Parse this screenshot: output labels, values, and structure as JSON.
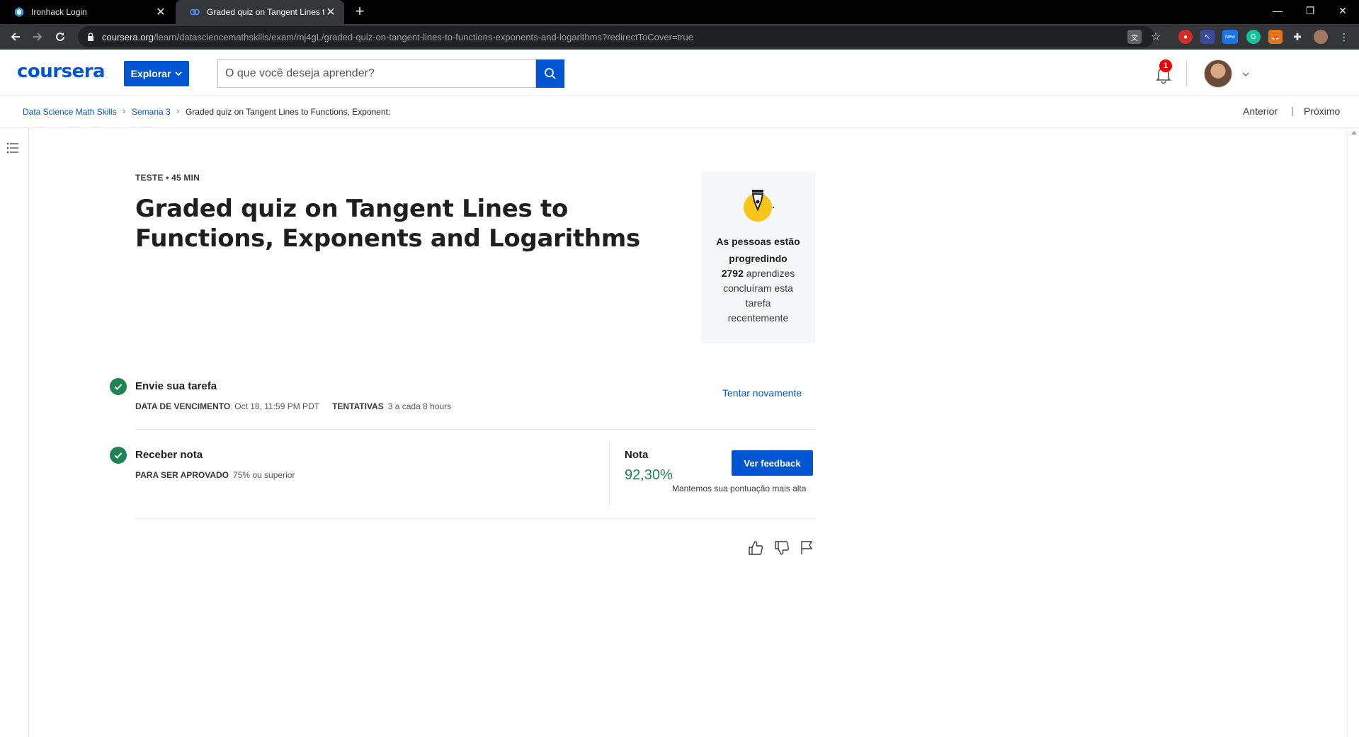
{
  "browser": {
    "tabs": [
      {
        "title": "Ironhack Login",
        "active": false
      },
      {
        "title": "Graded quiz on Tangent Lines to",
        "active": true
      }
    ],
    "url_host": "coursera.org",
    "url_path": "/learn/datasciencemathskills/exam/mj4gL/graded-quiz-on-tangent-lines-to-functions-exponents-and-logarithms?redirectToCover=true",
    "extensions": [
      "translate-icon",
      "star-icon",
      "lastpass-icon",
      "extension-icon",
      "new-extension-icon",
      "grammarly-icon",
      "fox-icon",
      "puzzle-icon",
      "profile-icon"
    ],
    "extension_new_label": "New"
  },
  "header": {
    "logo": "coursera",
    "explore_label": "Explorar",
    "search_placeholder": "O que você deseja aprender?",
    "notification_count": "1",
    "brand_color": "#0056d2"
  },
  "breadcrumb": {
    "items": [
      "Data Science Math Skills",
      "Semana 3",
      "Graded quiz on Tangent Lines to Functions, Exponent:"
    ],
    "prev_label": "Anterior",
    "next_label": "Próximo"
  },
  "quiz": {
    "kicker": "TESTE • 45 MIN",
    "title": "Graded quiz on Tangent Lines to Functions, Exponents and Logarithms"
  },
  "progress_card": {
    "heading": "As pessoas estão progredindo",
    "count": "2792",
    "body": "aprendizes concluíram esta tarefa recentemente"
  },
  "submit_step": {
    "title": "Envie sua tarefa",
    "due_label": "DATA DE VENCIMENTO",
    "due_value": "Oct 18, 11:59 PM PDT",
    "attempts_label": "TENTATIVAS",
    "attempts_value": "3 a cada 8 hours",
    "retry_label": "Tentar novamente"
  },
  "grade_step": {
    "title": "Receber nota",
    "pass_label": "PARA SER APROVADO",
    "pass_value": "75% ou superior",
    "grade_label": "Nota",
    "grade_value": "92,30%",
    "feedback_label": "Ver feedback",
    "keep_note": "Mantemos sua pontuação mais alta",
    "success_color": "#1f8354"
  },
  "feedback_icons": [
    "thumbs-up-icon",
    "thumbs-down-icon",
    "flag-icon"
  ]
}
